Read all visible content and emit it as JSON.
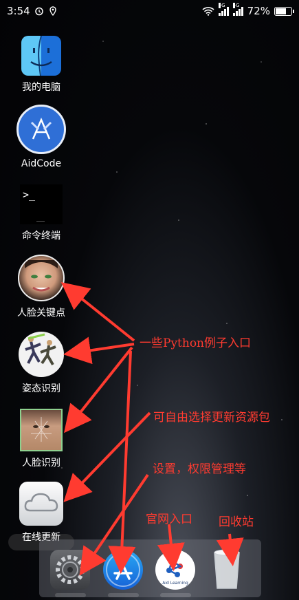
{
  "status_bar": {
    "time": "3:54",
    "network_1": "4G",
    "network_2": "4G",
    "battery_percent": "72%",
    "battery_level": 0.72
  },
  "desktop_icons": [
    {
      "label": "我的电脑",
      "icon": "finder-icon"
    },
    {
      "label": "AidCode",
      "icon": "aidcode-icon"
    },
    {
      "label": "命令终端",
      "icon": "terminal-icon",
      "prompt": ">_"
    },
    {
      "label": "人脸关键点",
      "icon": "face-landmark-icon"
    },
    {
      "label": "姿态识别",
      "icon": "pose-icon"
    },
    {
      "label": "人脸识别",
      "icon": "face-recognition-icon"
    },
    {
      "label": "在线更新",
      "icon": "icloud-icon"
    }
  ],
  "dock": [
    {
      "icon": "system-settings-icon"
    },
    {
      "icon": "app-store-icon"
    },
    {
      "icon": "aid-learning-icon",
      "text": "Aid Learning"
    },
    {
      "icon": "trash-icon"
    }
  ],
  "annotations": {
    "python_examples": "一些Python例子入口",
    "update_resources": "可自由选择更新资源包",
    "settings": "设置，权限管理等",
    "official_site": "官网入口",
    "recycle_bin": "回收站"
  },
  "colors": {
    "annotation": "#ff3b30",
    "aidcode_blue": "#2f6fd6"
  }
}
